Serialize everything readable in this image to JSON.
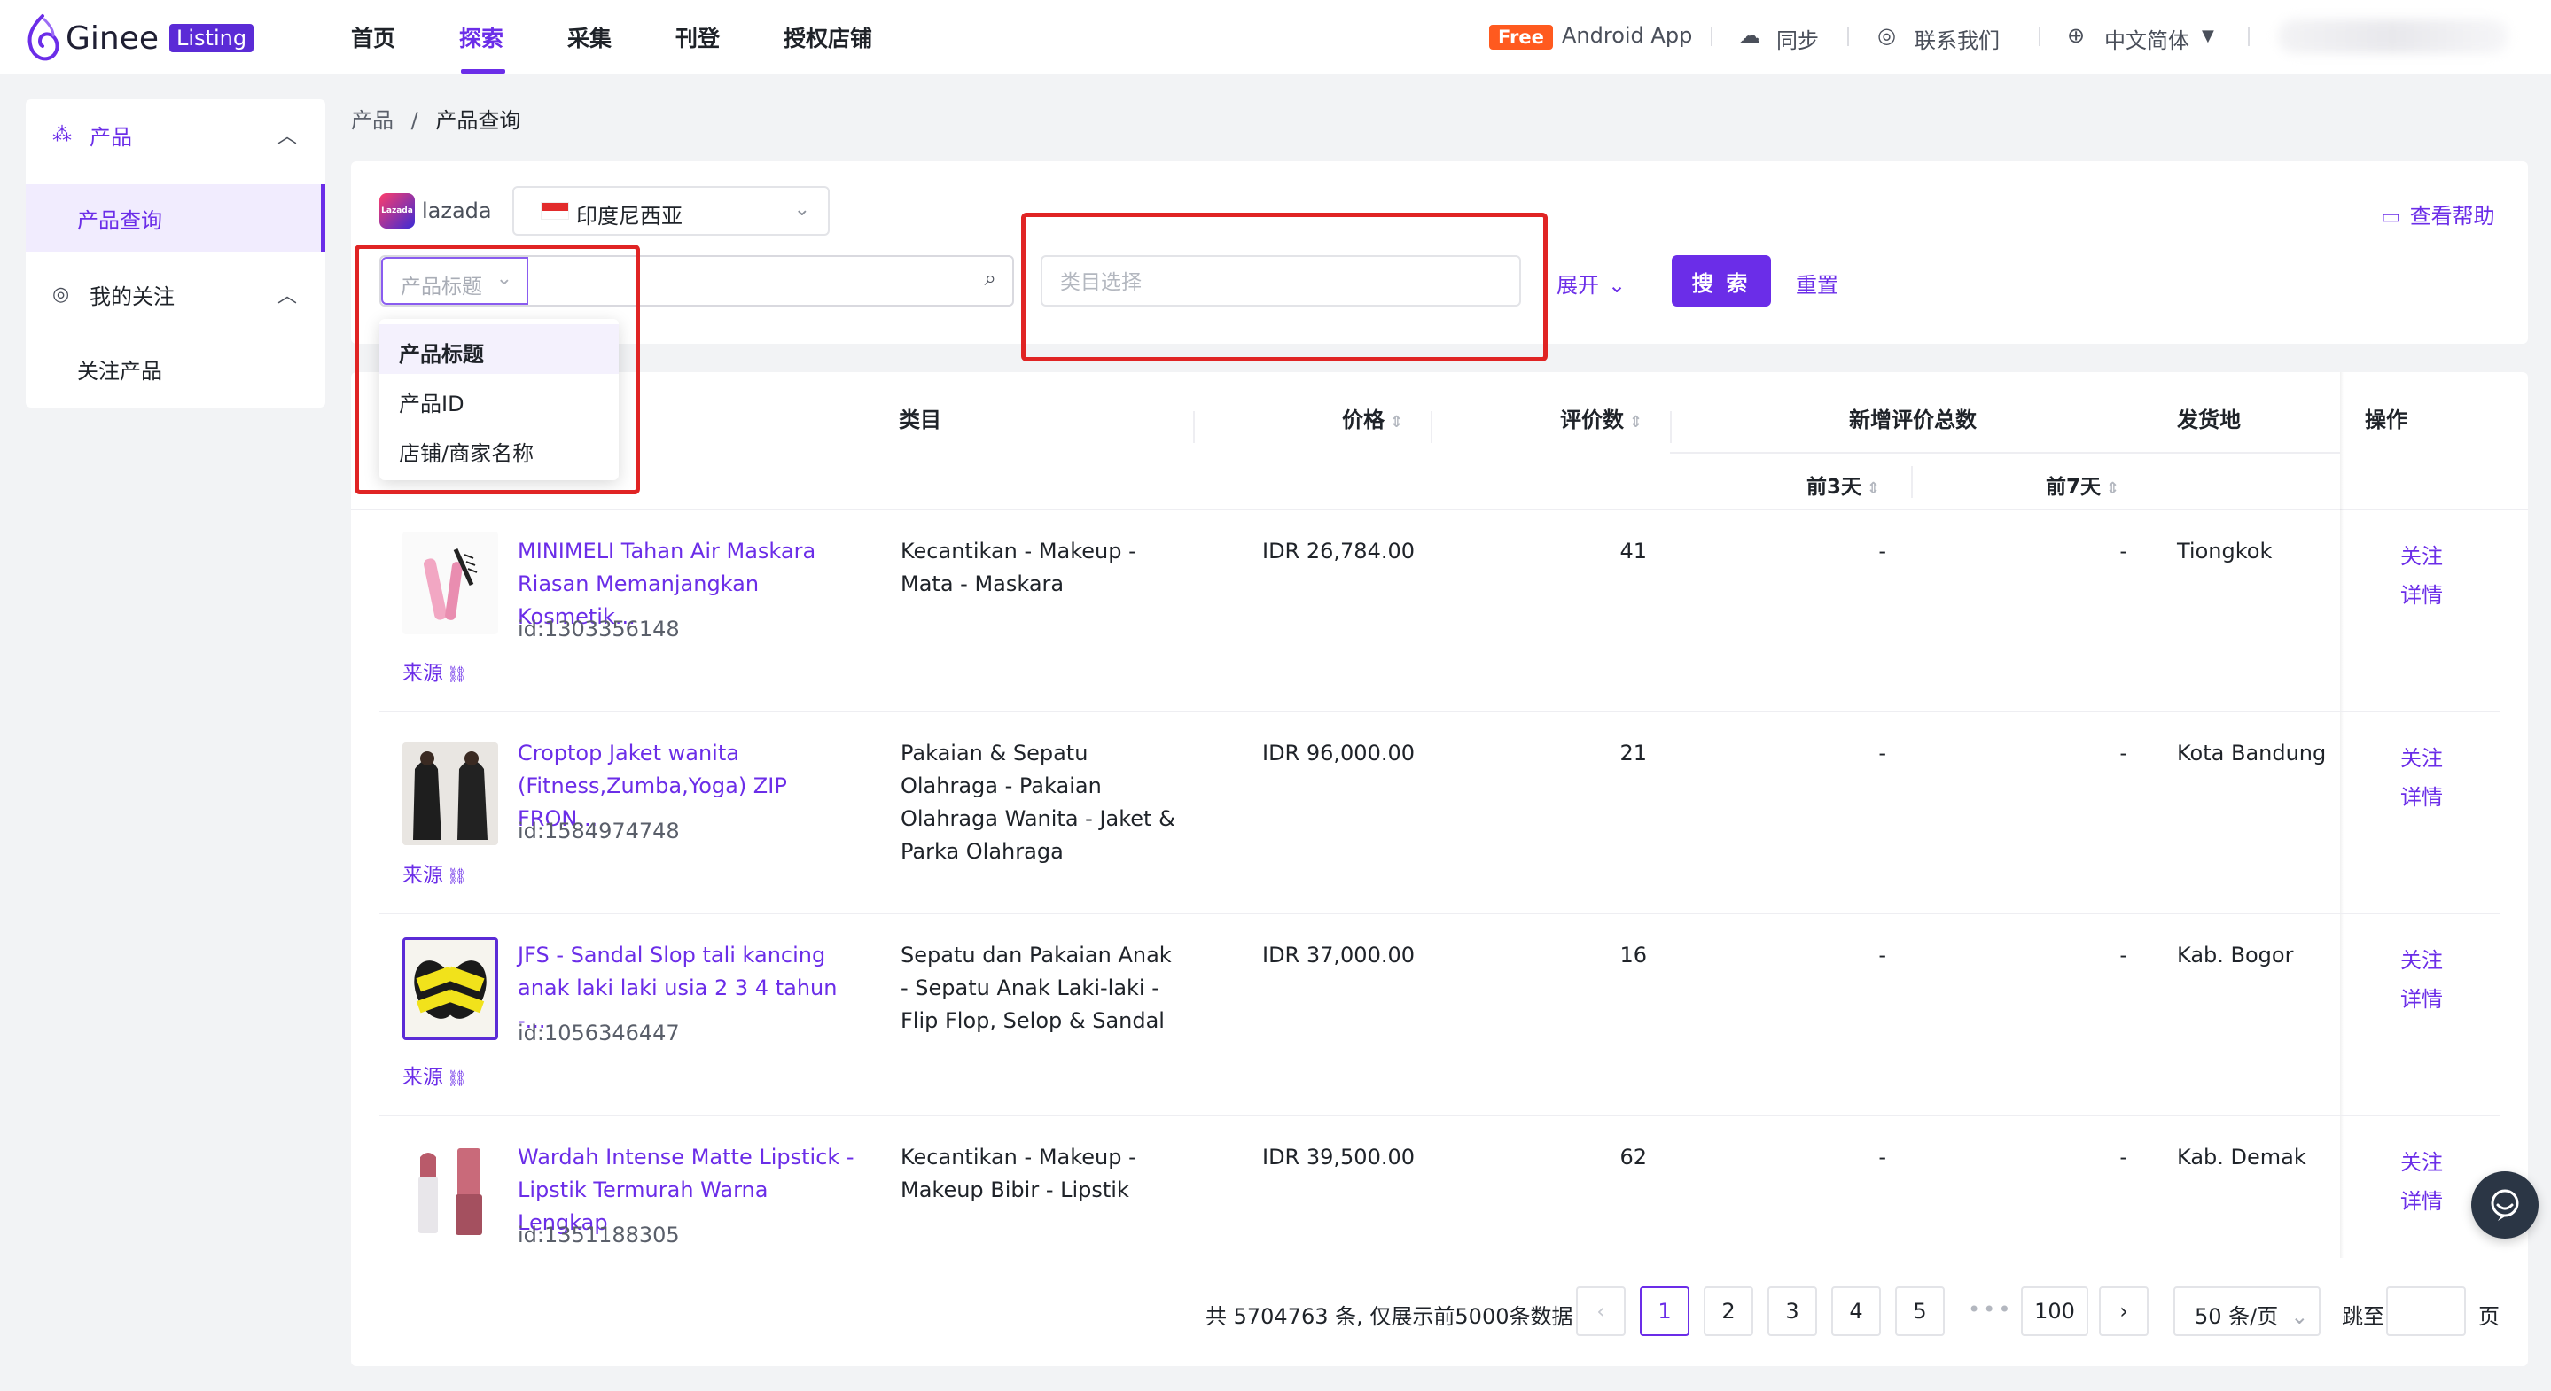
{
  "logo": {
    "name": "Ginee",
    "badge": "Listing"
  },
  "nav": {
    "items": [
      "首页",
      "探索",
      "采集",
      "刊登",
      "授权店铺"
    ],
    "active_index": 1
  },
  "topbar": {
    "free_badge": "Free",
    "android_app": "Android App",
    "sync": "同步",
    "contact": "联系我们",
    "language": "中文简体"
  },
  "sidebar": {
    "group1": {
      "label": "产品",
      "icon": "product-icon"
    },
    "group1_items": [
      "产品查询"
    ],
    "group2": {
      "label": "我的关注",
      "icon": "target-icon"
    },
    "group2_items": [
      "关注产品"
    ]
  },
  "breadcrumb": {
    "parent": "产品",
    "sep": "/",
    "current": "产品查询"
  },
  "filter": {
    "platform": "lazada",
    "platform_logo": "Lazada",
    "country": "印度尼西亚",
    "search_type": "产品标题",
    "search_value": "",
    "category_placeholder": "类目选择",
    "expand": "展开",
    "search_button": "搜 索",
    "reset": "重置",
    "help": "查看帮助"
  },
  "search_type_options": [
    "产品标题",
    "产品ID",
    "店铺/商家名称"
  ],
  "table": {
    "headers": {
      "category": "类目",
      "price": "价格",
      "reviews": "评价数",
      "new_reviews": "新增评价总数",
      "new_3d": "前3天",
      "new_7d": "前7天",
      "ship_from": "发货地",
      "ops": "操作"
    },
    "rows": [
      {
        "title": "MINIMELI Tahan Air Maskara Riasan Memanjangkan Kosmetik...",
        "id": "id:1303356148",
        "source": "来源",
        "category": "Kecantikan - Makeup - Mata - Maskara",
        "price": "IDR 26,784.00",
        "reviews": "41",
        "new_3d": "-",
        "new_7d": "-",
        "ship_from": "Tiongkok",
        "follow": "关注",
        "detail": "详情"
      },
      {
        "title": "Croptop Jaket wanita (Fitness,Zumba,Yoga) ZIP FRON...",
        "id": "id:1584974748",
        "source": "来源",
        "category": "Pakaian & Sepatu Olahraga - Pakaian Olahraga Wanita - Jaket & Parka Olahraga",
        "price": "IDR 96,000.00",
        "reviews": "21",
        "new_3d": "-",
        "new_7d": "-",
        "ship_from": "Kota Bandung",
        "follow": "关注",
        "detail": "详情"
      },
      {
        "title": "JFS - Sandal Slop tali kancing anak laki laki usia 2 3 4 tahun -...",
        "id": "id:1056346447",
        "source": "来源",
        "category": "Sepatu dan Pakaian Anak - Sepatu Anak Laki-laki - Flip Flop, Selop & Sandal",
        "price": "IDR 37,000.00",
        "reviews": "16",
        "new_3d": "-",
        "new_7d": "-",
        "ship_from": "Kab. Bogor",
        "follow": "关注",
        "detail": "详情"
      },
      {
        "title": "Wardah Intense Matte Lipstick - Lipstik Termurah Warna Lengkap",
        "id": "id:1351188305",
        "source": "来源",
        "category": "Kecantikan - Makeup - Makeup Bibir - Lipstik",
        "price": "IDR 39,500.00",
        "reviews": "62",
        "new_3d": "-",
        "new_7d": "-",
        "ship_from": "Kab. Demak",
        "follow": "关注",
        "detail": "详情"
      }
    ]
  },
  "pagination": {
    "total_text": "共 5704763 条, 仅展示前5000条数据",
    "prev": "‹",
    "pages": [
      "1",
      "2",
      "3",
      "4",
      "5"
    ],
    "dots": "•••",
    "last": "100",
    "next": "›",
    "page_size": "50 条/页",
    "jump_label": "跳至",
    "page_label": "页"
  },
  "colors": {
    "accent": "#6b2de8",
    "highlight": "#e02424"
  }
}
